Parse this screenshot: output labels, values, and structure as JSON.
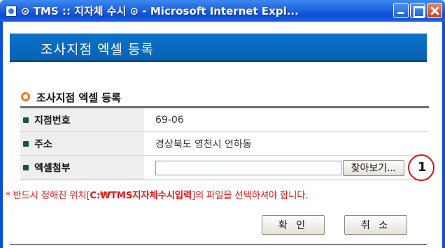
{
  "window": {
    "title": "⊙ TMS :: 지자체 수시 ⊙ - Microsoft Internet Expl..."
  },
  "banner": {
    "title": "조사지점 엑셀 등록"
  },
  "section": {
    "title": "조사지점 엑셀 등록"
  },
  "form": {
    "rows": [
      {
        "label": "지점번호",
        "value": "69-06"
      },
      {
        "label": "주소",
        "value": "경상북도 영천시 언하동"
      },
      {
        "label": "엑셀첨부",
        "value": ""
      }
    ],
    "browse_label": "찾아보기..."
  },
  "annotation": {
    "number": "1",
    "color": "#e01010"
  },
  "notice": {
    "prefix": "* 반드시 정해진 위치[",
    "path": "C:₩TMS지자체수시입력",
    "suffix": "]의 파일을 선택하셔야 합니다."
  },
  "buttons": {
    "ok": "확 인",
    "cancel": "취 소"
  },
  "colors": {
    "titlebar": "#0a4fd6",
    "banner": "#0a62b4",
    "section_bullet": "#f07a1c",
    "notice": "#e21b1b"
  }
}
